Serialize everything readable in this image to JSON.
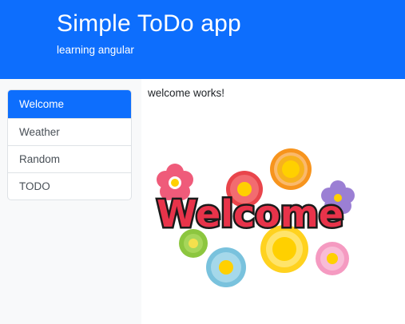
{
  "header": {
    "title": "Simple ToDo app",
    "subtitle": "learning angular"
  },
  "sidebar": {
    "items": [
      {
        "label": "Welcome",
        "active": true
      },
      {
        "label": "Weather",
        "active": false
      },
      {
        "label": "Random",
        "active": false
      },
      {
        "label": "TODO",
        "active": false
      }
    ]
  },
  "main": {
    "text": "welcome works!",
    "image_text": "Welcome"
  },
  "colors": {
    "primary": "#0d6efd",
    "sidebar_bg": "#f8f9fa",
    "border": "#dee2e6"
  }
}
